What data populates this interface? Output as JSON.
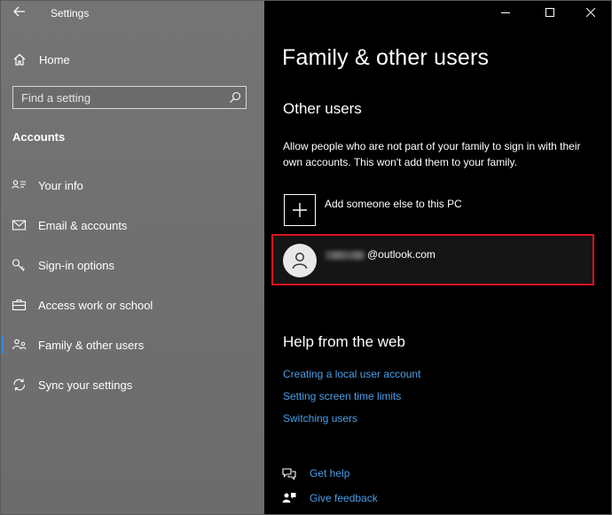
{
  "app": {
    "title": "Settings",
    "back_icon": "back-arrow-icon"
  },
  "sidebar": {
    "home_label": "Home",
    "search_placeholder": "Find a setting",
    "section_title": "Accounts",
    "items": [
      {
        "label": "Your info",
        "icon": "person-card-icon",
        "active": false
      },
      {
        "label": "Email & accounts",
        "icon": "mail-icon",
        "active": false
      },
      {
        "label": "Sign-in options",
        "icon": "key-icon",
        "active": false
      },
      {
        "label": "Access work or school",
        "icon": "briefcase-icon",
        "active": false
      },
      {
        "label": "Family & other users",
        "icon": "family-icon",
        "active": true
      },
      {
        "label": "Sync your settings",
        "icon": "sync-icon",
        "active": false
      }
    ],
    "active_accent": "#2e88d8"
  },
  "main": {
    "page_title": "Family & other users",
    "section_title": "Other users",
    "description": "Allow people who are not part of your family to sign in with their own accounts. This won't add them to your family.",
    "add_label": "Add someone else to this PC",
    "user": {
      "email_domain": "@outlook.com",
      "highlight_color": "#e0121b"
    },
    "help_title": "Help from the web",
    "help_links": [
      "Creating a local user account",
      "Setting screen time limits",
      "Switching users"
    ],
    "get_help": "Get help",
    "give_feedback": "Give feedback",
    "link_color": "#4a9fe8"
  }
}
